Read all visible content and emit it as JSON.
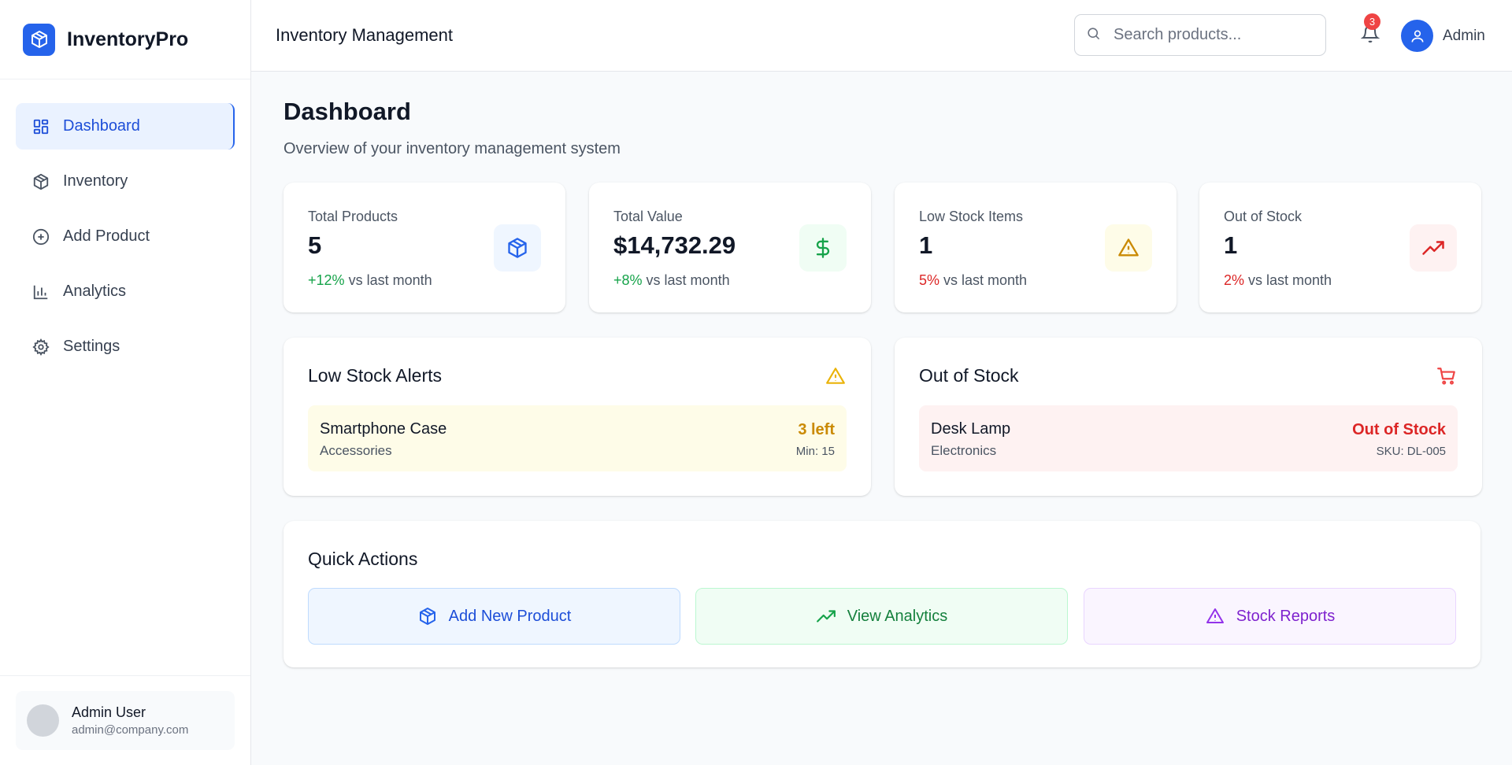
{
  "brand": {
    "name": "InventoryPro"
  },
  "sidebar": {
    "items": [
      {
        "label": "Dashboard",
        "icon": "dashboard-grid-icon"
      },
      {
        "label": "Inventory",
        "icon": "package-icon"
      },
      {
        "label": "Add Product",
        "icon": "plus-circle-icon"
      },
      {
        "label": "Analytics",
        "icon": "bar-chart-icon"
      },
      {
        "label": "Settings",
        "icon": "gear-icon"
      }
    ],
    "active": "Dashboard"
  },
  "user": {
    "name": "Admin User",
    "email": "admin@company.com"
  },
  "header": {
    "title": "Inventory Management",
    "search_placeholder": "Search products...",
    "notification_count": "3",
    "profile_name": "Admin"
  },
  "page": {
    "title": "Dashboard",
    "subtitle": "Overview of your inventory management system"
  },
  "stats": [
    {
      "label": "Total Products",
      "value": "5",
      "change": "+12%",
      "change_suffix": "vs last month",
      "trend": "positive",
      "icon": "package-icon",
      "color": "#2563eb"
    },
    {
      "label": "Total Value",
      "value": "$14,732.29",
      "change": "+8%",
      "change_suffix": "vs last month",
      "trend": "positive",
      "icon": "dollar-icon",
      "color": "#16a34a"
    },
    {
      "label": "Low Stock Items",
      "value": "1",
      "change": "5%",
      "change_suffix": "vs last month",
      "trend": "negative",
      "icon": "warning-icon",
      "color": "#ca8a04"
    },
    {
      "label": "Out of Stock",
      "value": "1",
      "change": "2%",
      "change_suffix": "vs last month",
      "trend": "negative",
      "icon": "trending-up-icon",
      "color": "#dc2626"
    }
  ],
  "low_stock": {
    "title": "Low Stock Alerts",
    "items": [
      {
        "name": "Smartphone Case",
        "category": "Accessories",
        "status": "3 left",
        "sub": "Min: 15"
      }
    ]
  },
  "out_of_stock": {
    "title": "Out of Stock",
    "items": [
      {
        "name": "Desk Lamp",
        "category": "Electronics",
        "status": "Out of Stock",
        "sub": "SKU: DL-005"
      }
    ]
  },
  "quick_actions": {
    "title": "Quick Actions",
    "buttons": [
      {
        "label": "Add New Product",
        "icon": "package-icon",
        "color": "#2563eb"
      },
      {
        "label": "View Analytics",
        "icon": "trending-up-icon",
        "color": "#16a34a"
      },
      {
        "label": "Stock Reports",
        "icon": "warning-icon",
        "color": "#9333ea"
      }
    ]
  }
}
